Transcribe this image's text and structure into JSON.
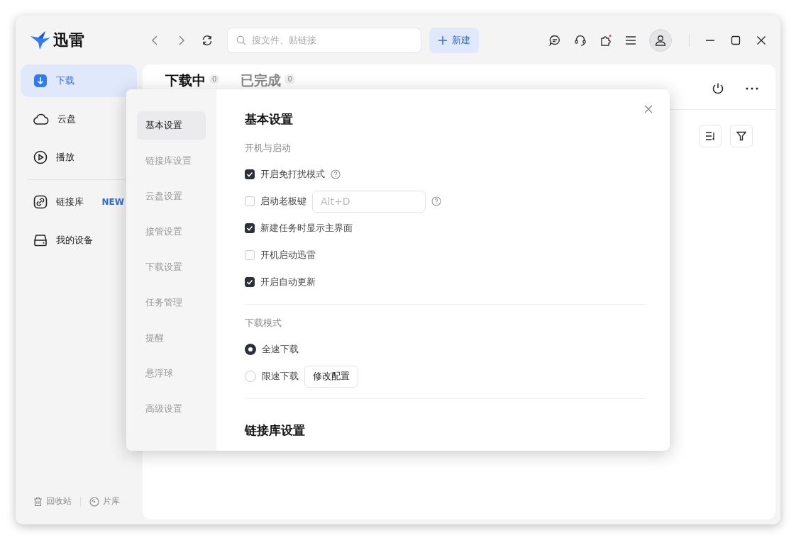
{
  "app": {
    "logo_text": "迅雷"
  },
  "toolbar": {
    "search": {
      "placeholder": "搜文件、贴链接"
    },
    "new_button": "新建"
  },
  "sidebar": {
    "groups": [
      [
        {
          "label": "下载",
          "selected": true
        },
        {
          "label": "云盘",
          "selected": false
        },
        {
          "label": "播放",
          "selected": false
        }
      ],
      [
        {
          "label": "链接库",
          "selected": false,
          "badge": "NEW"
        },
        {
          "label": "我的设备",
          "selected": false
        }
      ]
    ],
    "footer_links": [
      {
        "label": "回收站"
      },
      {
        "label": "片库"
      }
    ]
  },
  "main": {
    "tabs": [
      {
        "label": "下载中",
        "count": "0",
        "selected": true
      },
      {
        "label": "已完成",
        "count": "0",
        "selected": false
      }
    ]
  },
  "dialog": {
    "nav": [
      {
        "label": "基本设置",
        "selected": true
      },
      {
        "label": "链接库设置",
        "selected": false
      },
      {
        "label": "云盘设置",
        "selected": false
      },
      {
        "label": "接管设置",
        "selected": false
      },
      {
        "label": "下载设置",
        "selected": false
      },
      {
        "label": "任务管理",
        "selected": false
      },
      {
        "label": "提醒",
        "selected": false
      },
      {
        "label": "悬浮球",
        "selected": false
      },
      {
        "label": "高级设置",
        "selected": false
      }
    ],
    "title": "基本设置",
    "sections": [
      {
        "heading": "开机与启动",
        "options": [
          {
            "kind": "checkbox",
            "label": "开启免打扰模式",
            "checked": true,
            "help": true
          },
          {
            "kind": "checkbox",
            "label": "启动老板键",
            "checked": false,
            "help": true,
            "hotkey": {
              "value": "Alt+D",
              "disabled": true
            }
          },
          {
            "kind": "checkbox",
            "label": "新建任务时显示主界面",
            "checked": true,
            "help": false
          },
          {
            "kind": "checkbox",
            "label": "开机启动迅雷",
            "checked": false,
            "help": false
          },
          {
            "kind": "checkbox",
            "label": "开启自动更新",
            "checked": true,
            "help": false
          }
        ]
      },
      {
        "heading": "下载模式",
        "options": [
          {
            "kind": "radio",
            "label": "全速下载",
            "selected": true
          },
          {
            "kind": "radio",
            "label": "限速下载",
            "selected": false,
            "button": "修改配置"
          }
        ]
      }
    ],
    "next_title": "链接库设置"
  }
}
